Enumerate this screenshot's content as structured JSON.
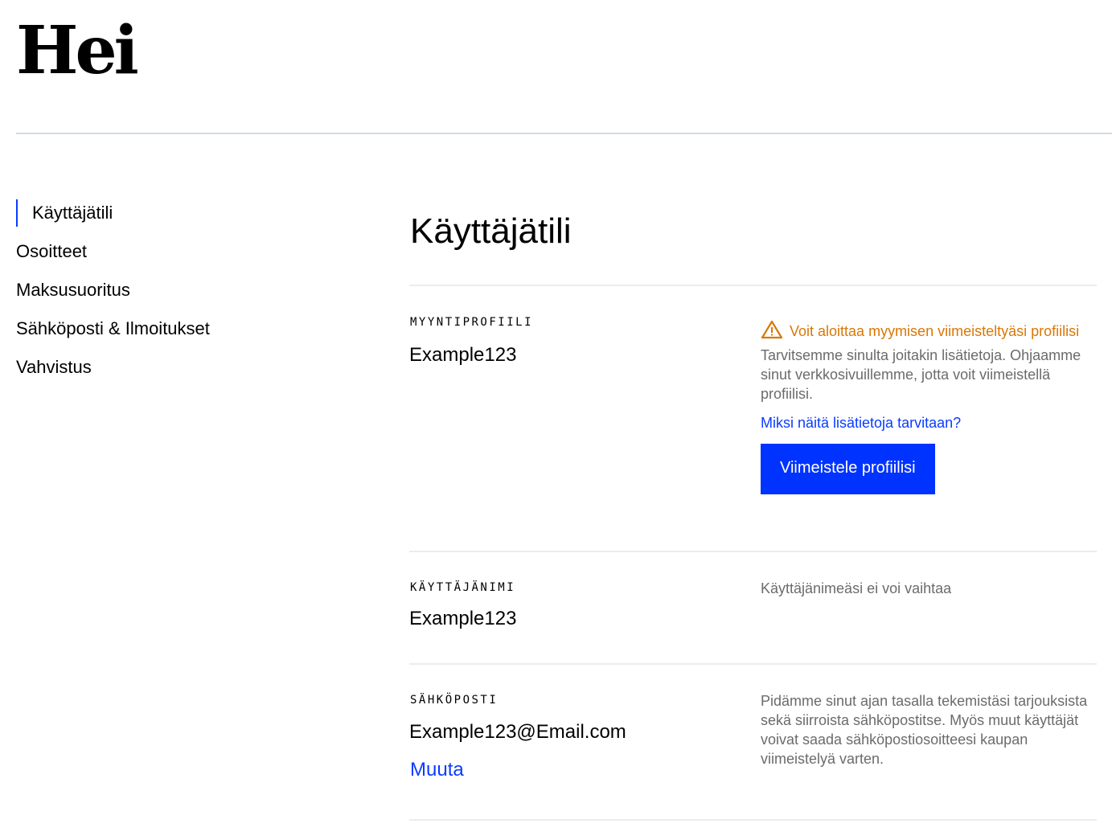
{
  "header": {
    "title": "Hei"
  },
  "sidebar": {
    "items": [
      {
        "label": "Käyttäjätili",
        "active": true
      },
      {
        "label": "Osoitteet"
      },
      {
        "label": "Maksusuoritus"
      },
      {
        "label": "Sähköposti & Ilmoitukset"
      },
      {
        "label": "Vahvistus"
      }
    ]
  },
  "main": {
    "title": "Käyttäjätili",
    "seller_profile": {
      "label": "MYYNTIPROFIILI",
      "value": "Example123",
      "warning": "Voit aloittaa myymisen viimeisteltyäsi profiilisi",
      "description": "Tarvitsemme sinulta joitakin lisätietoja. Ohjaamme sinut verkkosivuillemme, jotta voit viimeistellä profiilisi.",
      "link": "Miksi näitä lisätietoja tarvitaan?",
      "button": "Viimeistele profiilisi"
    },
    "username": {
      "label": "KÄYTTÄJÄNIMI",
      "value": "Example123",
      "note": "Käyttäjänimeäsi ei voi vaihtaa"
    },
    "email": {
      "label": "SÄHKÖPOSTI",
      "value": "Example123@Email.com",
      "change": "Muuta",
      "note": "Pidämme sinut ajan tasalla tekemistäsi tarjouksista sekä siirroista sähköpostitse. Myös muut käyttäjät voivat saada sähköpostiosoitteesi kaupan viimeistelyä varten."
    }
  },
  "colors": {
    "accent": "#0033ff",
    "warning": "#d97706",
    "muted": "#6b6b6b"
  }
}
